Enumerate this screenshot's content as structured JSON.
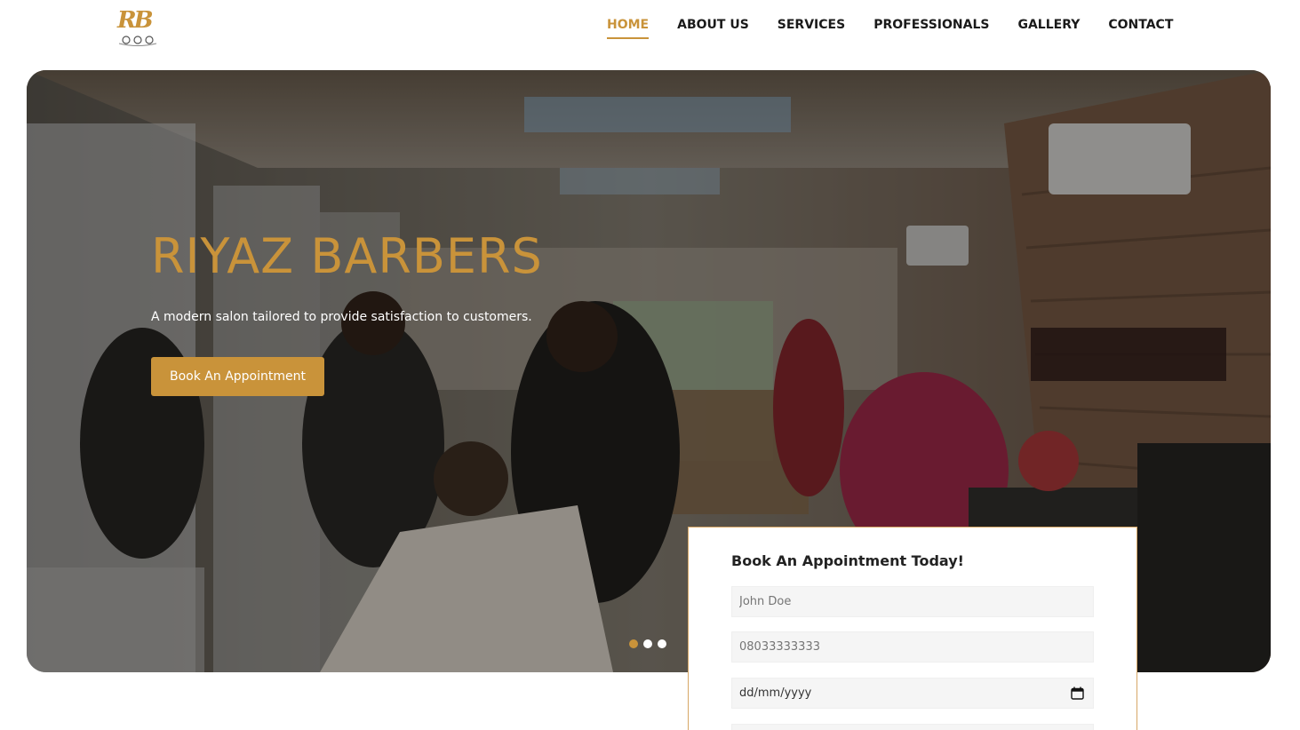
{
  "brand": {
    "logo_text": "RB",
    "accent_color": "#c9933a"
  },
  "nav": {
    "items": [
      {
        "label": "HOME",
        "active": true
      },
      {
        "label": "ABOUT US",
        "active": false
      },
      {
        "label": "SERVICES",
        "active": false
      },
      {
        "label": "PROFESSIONALS",
        "active": false
      },
      {
        "label": "GALLERY",
        "active": false
      },
      {
        "label": "CONTACT",
        "active": false
      }
    ]
  },
  "hero": {
    "title": "RIYAZ BARBERS",
    "subtitle": "A modern salon tailored to provide satisfaction to customers.",
    "cta_label": "Book An Appointment",
    "slides": {
      "count": 3,
      "active_index": 0
    }
  },
  "booking": {
    "title": "Book An Appointment Today!",
    "name_placeholder": "John Doe",
    "phone_placeholder": "08033333333",
    "date_placeholder": "dd/mm/yyyy",
    "date_icon": "calendar-icon"
  }
}
